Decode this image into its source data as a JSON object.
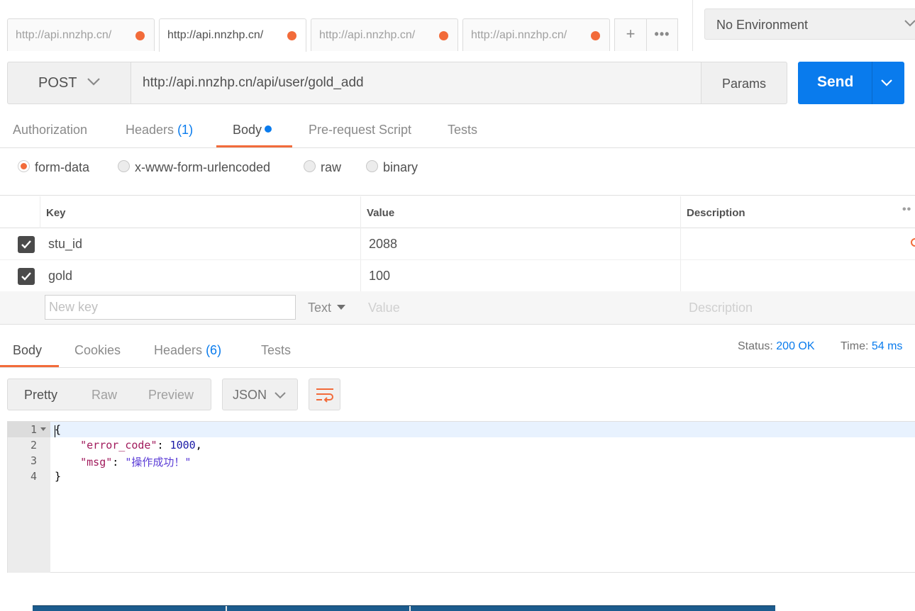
{
  "tabs": [
    {
      "label": "http://api.nnzhp.cn/",
      "active": false
    },
    {
      "label": "http://api.nnzhp.cn/",
      "active": true
    },
    {
      "label": "http://api.nnzhp.cn/",
      "active": false
    },
    {
      "label": "http://api.nnzhp.cn/",
      "active": false
    }
  ],
  "tab_actions": {
    "add": "+",
    "more": "•••"
  },
  "environment": {
    "selected": "No Environment"
  },
  "request": {
    "method": "POST",
    "url": "http://api.nnzhp.cn/api/user/gold_add",
    "params_label": "Params",
    "send_label": "Send"
  },
  "request_tabs": {
    "authorization": "Authorization",
    "headers": "Headers",
    "headers_count": "(1)",
    "body": "Body",
    "prerequest": "Pre-request Script",
    "tests": "Tests",
    "active": "Body"
  },
  "body_types": {
    "form_data": "form-data",
    "urlencoded": "x-www-form-urlencoded",
    "raw": "raw",
    "binary": "binary",
    "selected": "form-data"
  },
  "kv_table": {
    "headers": {
      "key": "Key",
      "value": "Value",
      "description": "Description"
    },
    "rows": [
      {
        "key": "stu_id",
        "value": "2088",
        "checked": true
      },
      {
        "key": "gold",
        "value": "100",
        "checked": true
      }
    ],
    "new_row": {
      "key_placeholder": "New key",
      "type": "Text",
      "value_placeholder": "Value",
      "description_placeholder": "Description"
    }
  },
  "response_tabs": {
    "body": "Body",
    "cookies": "Cookies",
    "headers": "Headers",
    "headers_count": "(6)",
    "tests": "Tests",
    "active": "Body"
  },
  "response_meta": {
    "status_label": "Status:",
    "status_value": "200 OK",
    "time_label": "Time:",
    "time_value": "54 ms"
  },
  "view_modes": {
    "pretty": "Pretty",
    "raw": "Raw",
    "preview": "Preview",
    "active": "Pretty"
  },
  "format": {
    "selected": "JSON"
  },
  "response_code": {
    "line_numbers": [
      "1",
      "2",
      "3",
      "4"
    ],
    "open_brace": "{",
    "close_brace": "}",
    "key1": "\"error_code\"",
    "val1": "1000",
    "key2": "\"msg\"",
    "val2": "\"操作成功！\""
  },
  "colors": {
    "accent": "#f26b3a",
    "primary": "#097bed",
    "text": "#505050"
  }
}
